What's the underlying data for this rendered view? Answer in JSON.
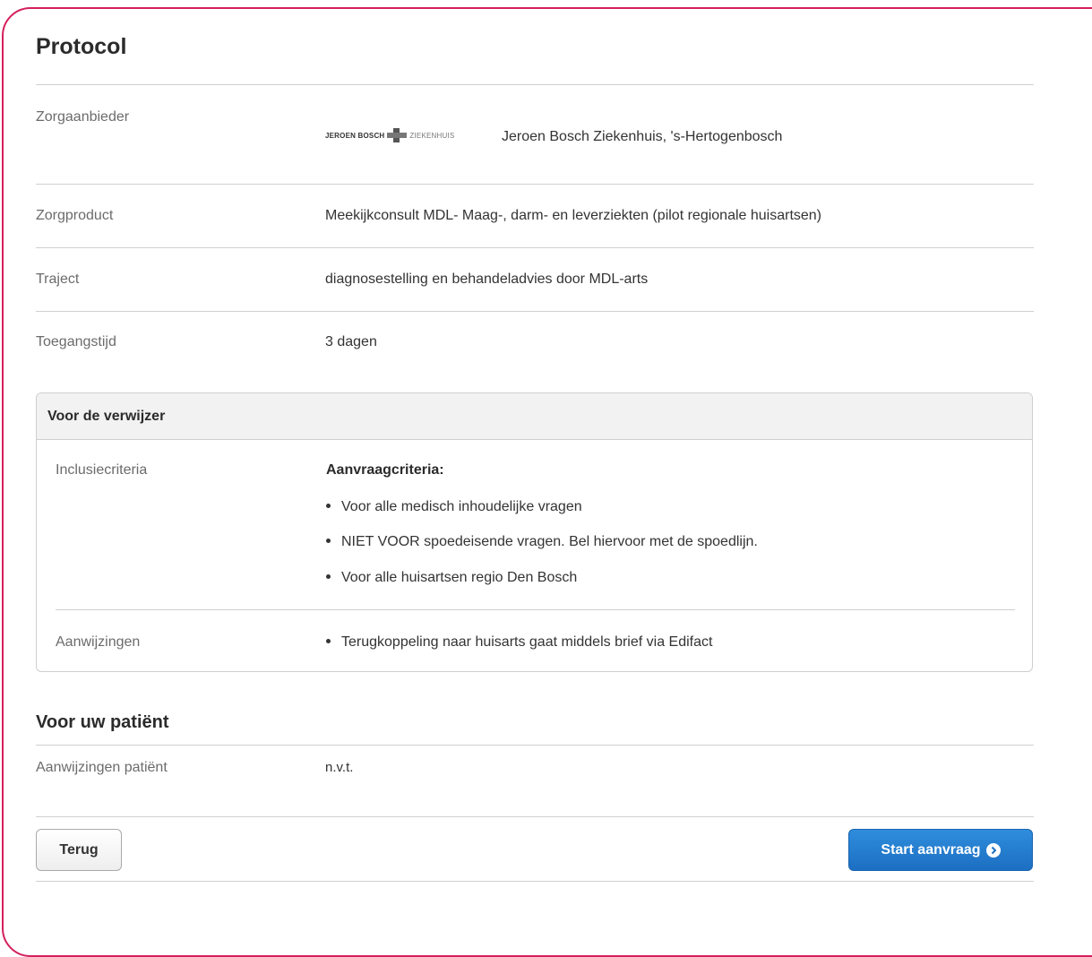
{
  "page": {
    "title": "Protocol"
  },
  "details": {
    "provider_label": "Zorgaanbieder",
    "provider_logo": {
      "left": "JEROEN BOSCH",
      "right": "ZIEKENHUIS"
    },
    "provider_name": "Jeroen Bosch Ziekenhuis, 's-Hertogenbosch",
    "product_label": "Zorgproduct",
    "product_value": "Meekijkconsult MDL- Maag-, darm- en leverziekten (pilot regionale huisartsen)",
    "trajectory_label": "Traject",
    "trajectory_value": "diagnosestelling en behandeladvies door MDL-arts",
    "access_time_label": "Toegangstijd",
    "access_time_value": "3 dagen"
  },
  "referrer": {
    "heading": "Voor de verwijzer",
    "inclusion_label": "Inclusiecriteria",
    "criteria_heading": "Aanvraagcriteria:",
    "criteria": [
      "Voor alle medisch inhoudelijke vragen",
      "NIET VOOR spoedeisende vragen. Bel hiervoor met de spoedlijn.",
      "Voor alle huisartsen regio Den Bosch"
    ],
    "instructions_label": "Aanwijzingen",
    "instructions": [
      "Terugkoppeling naar huisarts gaat middels brief via Edifact"
    ]
  },
  "patient": {
    "heading": "Voor uw patiënt",
    "instructions_label": "Aanwijzingen patiënt",
    "instructions_value": "n.v.t."
  },
  "actions": {
    "back_label": "Terug",
    "start_label": "Start aanvraag"
  },
  "colors": {
    "frame": "#d41f5e",
    "primary": "#1c6fc2"
  }
}
